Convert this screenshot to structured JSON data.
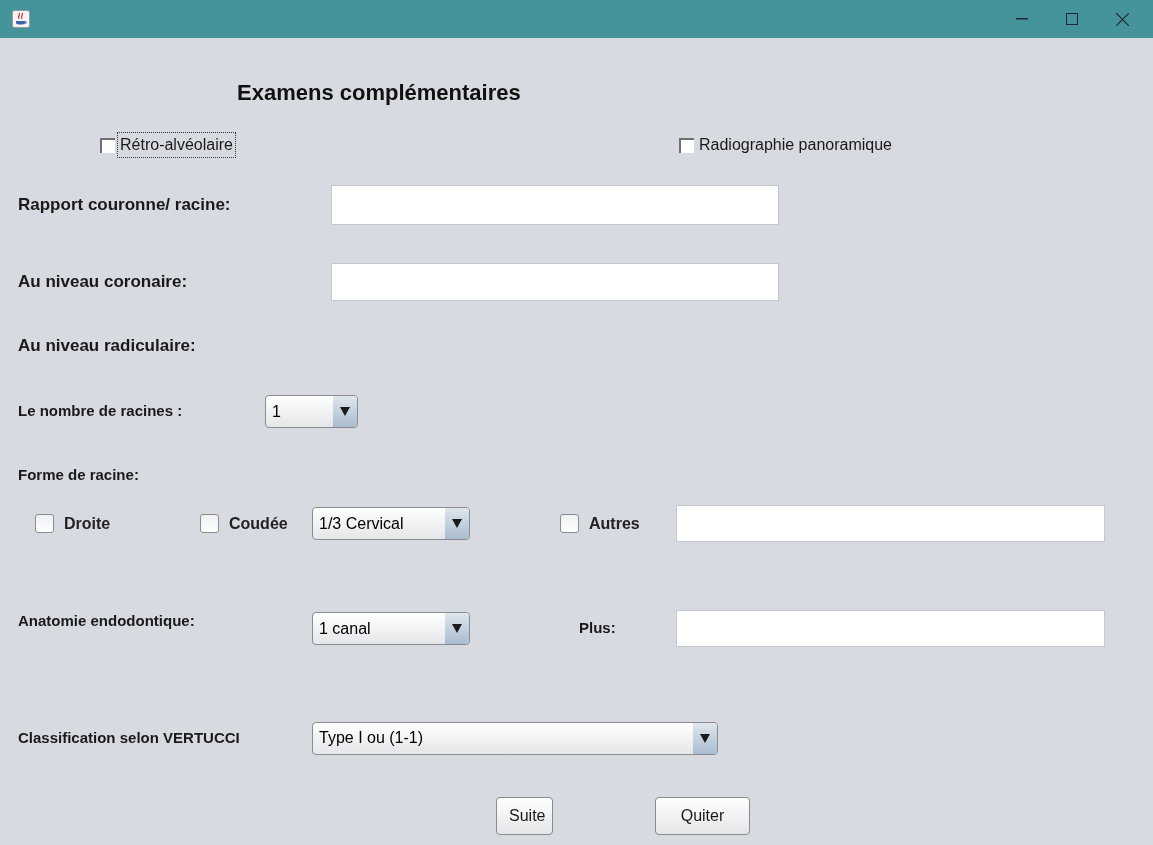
{
  "heading": "Examens complémentaires",
  "exam_checkboxes": [
    {
      "label": "Rétro-alvéolaire",
      "checked": false,
      "focused": true
    },
    {
      "label": "Radiographie panoramique",
      "checked": false,
      "focused": false
    }
  ],
  "rapport": {
    "label": "Rapport couronne/ racine:"
  },
  "coronaire": {
    "label": "Au niveau coronaire:"
  },
  "radiculaire_heading": "Au niveau radiculaire:",
  "nombre_racines": {
    "label": "Le nombre de racines :",
    "value": "1"
  },
  "forme_racine": {
    "label": "Forme de racine:",
    "droite": {
      "label": "Droite",
      "checked": false
    },
    "coudee": {
      "label": "Coudée",
      "checked": false
    },
    "coudee_choice": "1/3 Cervical",
    "autres": {
      "label": "Autres",
      "checked": false
    }
  },
  "anatomie": {
    "label": "Anatomie endodontique:",
    "value": "1 canal",
    "plus_label": "Plus:"
  },
  "vertucci": {
    "label": "Classification selon VERTUCCI",
    "value": "Type I ou (1-1)"
  },
  "buttons": [
    "Suite",
    "Quiter"
  ]
}
